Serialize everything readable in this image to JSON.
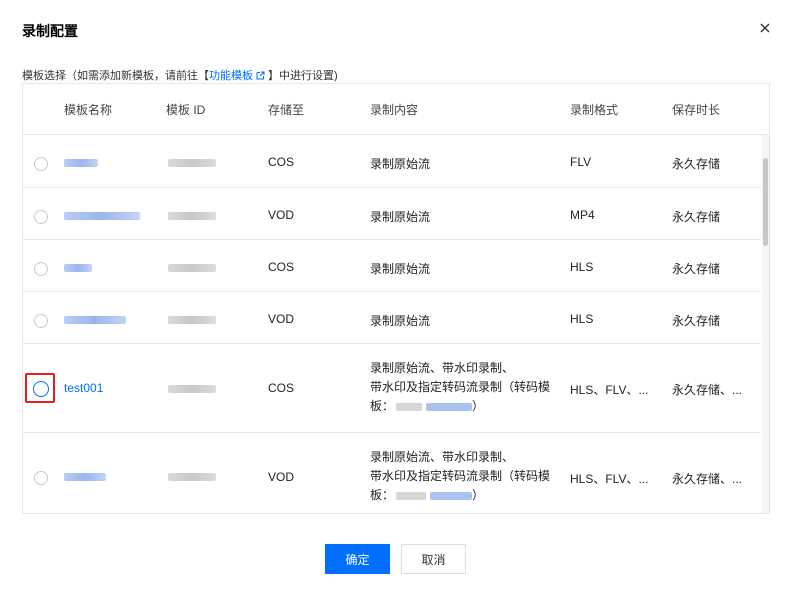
{
  "dialog": {
    "title": "录制配置",
    "hint_prefix": "模板选择（如需添加新模板，请前往【",
    "hint_link": "功能模板",
    "hint_suffix": "】中进行设置)"
  },
  "table": {
    "headers": [
      "模板名称",
      "模板 ID",
      "存储至",
      "录制内容",
      "录制格式",
      "保存时长"
    ],
    "rows": [
      {
        "name": "",
        "storage": "COS",
        "content": "录制原始流",
        "format": "FLV",
        "duration": "永久存储"
      },
      {
        "name": "",
        "storage": "VOD",
        "content": "录制原始流",
        "format": "MP4",
        "duration": "永久存储"
      },
      {
        "name": "",
        "storage": "COS",
        "content": "录制原始流",
        "format": "HLS",
        "duration": "永久存储"
      },
      {
        "name": "",
        "storage": "VOD",
        "content": "录制原始流",
        "format": "HLS",
        "duration": "永久存储"
      },
      {
        "name": "test001",
        "storage": "COS",
        "content_line1": "录制原始流、带水印录制、",
        "content_line2": "带水印及指定转码流录制（转码模",
        "content_line3_prefix": "板：",
        "content_line3_suffix": "）",
        "format": "HLS、FLV、...",
        "duration": "永久存储、..."
      },
      {
        "name": "",
        "storage": "VOD",
        "content_line1": "录制原始流、带水印录制、",
        "content_line2": "带水印及指定转码流录制（转码模",
        "content_line3_prefix": "板：",
        "content_line3_suffix": "）",
        "format": "HLS、FLV、...",
        "duration": "永久存储、..."
      }
    ]
  },
  "footer": {
    "confirm_label": "确定",
    "cancel_label": "取消"
  },
  "colors": {
    "accent": "#006eff",
    "highlight": "#e02020"
  },
  "icons": [
    "close-icon",
    "external-link-icon"
  ]
}
